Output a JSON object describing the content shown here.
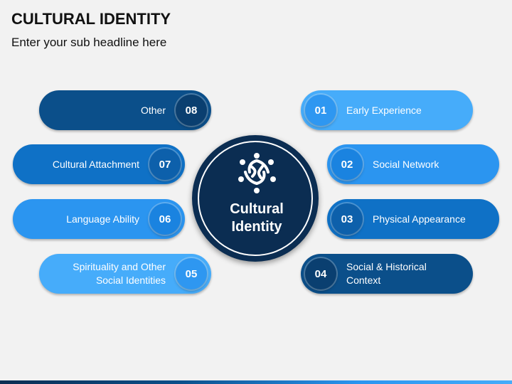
{
  "header": {
    "title": "CULTURAL IDENTITY",
    "subtitle": "Enter your sub headline here"
  },
  "hub": {
    "label": "Cultural\nIdentity",
    "icon": "people-circle-icon"
  },
  "items": [
    {
      "number": "01",
      "label": "Early Experience"
    },
    {
      "number": "02",
      "label": "Social Network"
    },
    {
      "number": "03",
      "label": "Physical Appearance"
    },
    {
      "number": "04",
      "label": "Social & Historical\nContext"
    },
    {
      "number": "05",
      "label": "Spirituality and Other\nSocial Identities"
    },
    {
      "number": "06",
      "label": "Language Ability"
    },
    {
      "number": "07",
      "label": "Cultural Attachment"
    },
    {
      "number": "08",
      "label": "Other"
    }
  ],
  "colors": {
    "dark": "#0b4f8a",
    "mid": "#0f71c6",
    "light": "#2b95f0",
    "lighter": "#46acfa",
    "hub": "#0b2d52"
  }
}
